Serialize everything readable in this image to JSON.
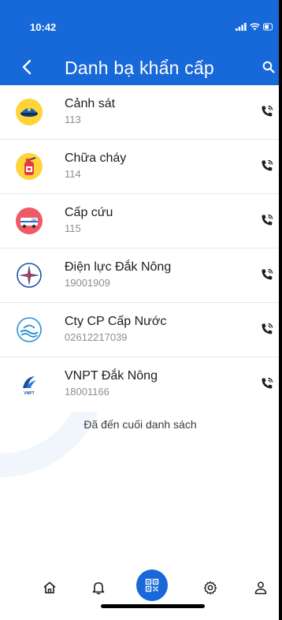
{
  "status_bar": {
    "time": "10:42"
  },
  "header": {
    "title": "Danh bạ khẩn cấp"
  },
  "contacts": [
    {
      "name": "Cảnh sát",
      "number": "113",
      "icon": "police-icon"
    },
    {
      "name": "Chữa cháy",
      "number": "114",
      "icon": "fire-extinguisher-icon"
    },
    {
      "name": "Cấp cứu",
      "number": "115",
      "icon": "ambulance-icon"
    },
    {
      "name": "Điện lực Đắk Nông",
      "number": "19001909",
      "icon": "electricity-logo-icon"
    },
    {
      "name": "Cty CP Cấp Nước",
      "number": "02612217039",
      "icon": "water-company-logo-icon"
    },
    {
      "name": "VNPT Đắk Nông",
      "number": "18001166",
      "icon": "vnpt-logo-icon",
      "logo_text": "VNPT"
    }
  ],
  "end_of_list": "Đã đến cuối danh sách",
  "bottom_nav": [
    "home-icon",
    "bell-icon",
    "qr-code-icon",
    "settings-gear-icon",
    "profile-icon"
  ],
  "colors": {
    "primary": "#1768d8",
    "text": "#1d1d1f",
    "subtext": "#8e8e93"
  }
}
